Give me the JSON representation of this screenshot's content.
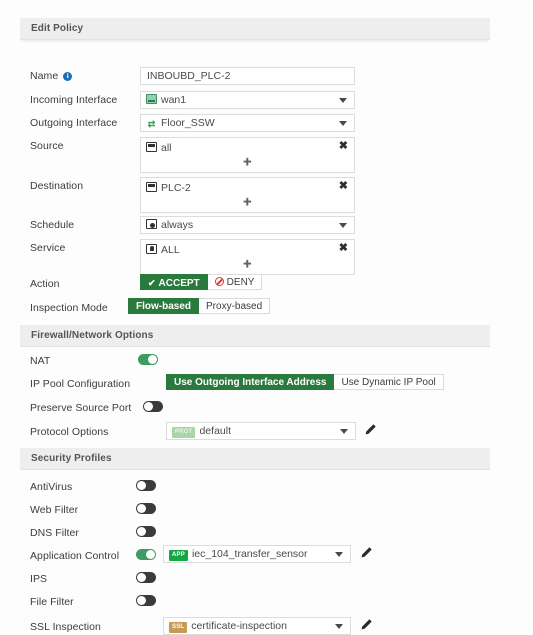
{
  "dialog": {
    "title": "Edit Policy"
  },
  "form": {
    "name": {
      "label": "Name",
      "value": "INBOUBD_PLC-2",
      "placeholder": "Name"
    },
    "incoming_interface": {
      "label": "Incoming Interface",
      "value": "wan1",
      "icon": "interface-icon"
    },
    "outgoing_interface": {
      "label": "Outgoing Interface",
      "value": "Floor_SSW",
      "icon": "switch-icon"
    },
    "source": {
      "label": "Source",
      "items": [
        "all"
      ],
      "icon": "address-object-icon",
      "remove_label": "✖",
      "add_label": "+"
    },
    "destination": {
      "label": "Destination",
      "items": [
        "PLC-2"
      ],
      "icon": "address-object-icon",
      "remove_label": "✖",
      "add_label": "+"
    },
    "schedule": {
      "label": "Schedule",
      "value": "always",
      "icon": "schedule-icon"
    },
    "service": {
      "label": "Service",
      "items": [
        "ALL"
      ],
      "icon": "service-icon",
      "remove_label": "✖",
      "add_label": "+"
    },
    "action": {
      "label": "Action",
      "options": [
        "ACCEPT",
        "DENY"
      ],
      "selected": "ACCEPT",
      "check_glyph": "✔"
    },
    "inspection_mode": {
      "label": "Inspection Mode",
      "options": [
        "Flow-based",
        "Proxy-based"
      ],
      "selected": "Flow-based"
    }
  },
  "firewall_section": {
    "title": "Firewall/Network Options",
    "nat": {
      "label": "NAT",
      "state": "on"
    },
    "ip_pool": {
      "label": "IP Pool Configuration",
      "options": [
        "Use Outgoing Interface Address",
        "Use Dynamic IP Pool"
      ],
      "selected": "Use Outgoing Interface Address"
    },
    "preserve_source_port": {
      "label": "Preserve Source Port",
      "state": "off"
    },
    "protocol_options": {
      "label": "Protocol Options",
      "value": "default",
      "badge": "PROT"
    }
  },
  "security_section": {
    "title": "Security Profiles",
    "profiles": [
      {
        "label": "AntiVirus",
        "state": "off"
      },
      {
        "label": "Web Filter",
        "state": "off"
      },
      {
        "label": "DNS Filter",
        "state": "off"
      },
      {
        "label": "Application Control",
        "state": "on",
        "value": "iec_104_transfer_sensor",
        "badge": "APP"
      },
      {
        "label": "IPS",
        "state": "off"
      },
      {
        "label": "File Filter",
        "state": "off"
      },
      {
        "label": "SSL Inspection",
        "state": "none",
        "value": "certificate-inspection",
        "badge": "SSL"
      }
    ]
  },
  "colors": {
    "accent_green": "#2b7a3d",
    "toggle_on": "#3e9b62",
    "deny_red": "#d03a3a",
    "info_blue": "#1d6fb8",
    "app_badge": "#14a844",
    "ssl_badge": "#c79a56",
    "section_bar": "#eeeeee"
  }
}
